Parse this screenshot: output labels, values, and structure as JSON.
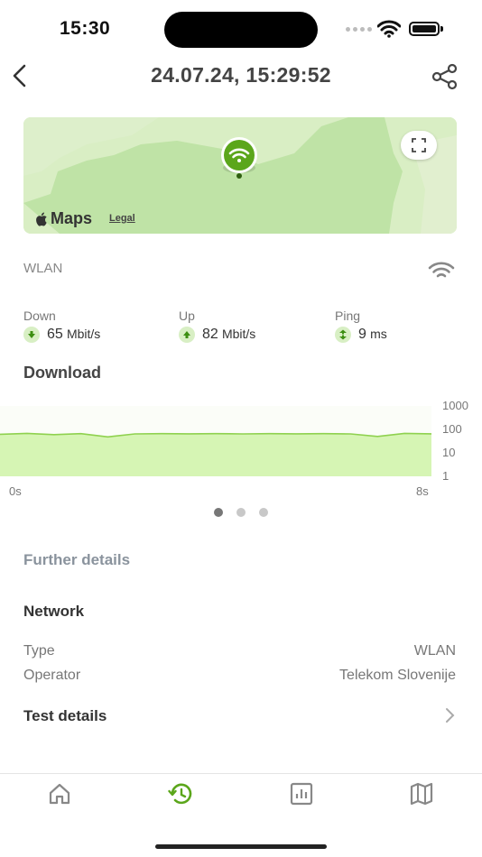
{
  "status": {
    "time": "15:30"
  },
  "header": {
    "title": "24.07.24, 15:29:52"
  },
  "map": {
    "brand": "Maps",
    "legal": "Legal"
  },
  "connection": {
    "type_label": "WLAN"
  },
  "metrics": {
    "down": {
      "label": "Down",
      "value": "65",
      "unit": "Mbit/s"
    },
    "up": {
      "label": "Up",
      "value": "82",
      "unit": "Mbit/s"
    },
    "ping": {
      "label": "Ping",
      "value": "9",
      "unit": "ms"
    }
  },
  "chart_data": {
    "type": "area",
    "title": "Download",
    "xlabel": "",
    "ylabel": "",
    "scale": "log",
    "ylim": [
      1,
      1000
    ],
    "y_ticks": [
      "1000",
      "100",
      "10",
      "1"
    ],
    "x_ticks": [
      "0s",
      "8s"
    ],
    "x": [
      0,
      0.5,
      1,
      1.5,
      2,
      2.5,
      3,
      3.5,
      4,
      4.5,
      5,
      5.5,
      6,
      6.5,
      7,
      7.5,
      8
    ],
    "values": [
      62,
      68,
      60,
      66,
      48,
      64,
      66,
      65,
      66,
      64,
      66,
      65,
      66,
      64,
      50,
      68,
      65
    ],
    "colors": {
      "fill": "#d6f5b4",
      "line": "#8fd14f"
    }
  },
  "pager": {
    "count": 3,
    "active": 0
  },
  "details": {
    "further_label": "Further details",
    "network_label": "Network",
    "rows": [
      {
        "label": "Type",
        "value": "WLAN"
      },
      {
        "label": "Operator",
        "value": "Telekom Slovenije"
      }
    ],
    "test_details_label": "Test details"
  },
  "tabbar": {
    "icons": [
      "home-icon",
      "history-icon",
      "stats-icon",
      "map-icon"
    ],
    "active": 1,
    "active_color": "#5ba61b",
    "inactive_color": "#888888"
  }
}
